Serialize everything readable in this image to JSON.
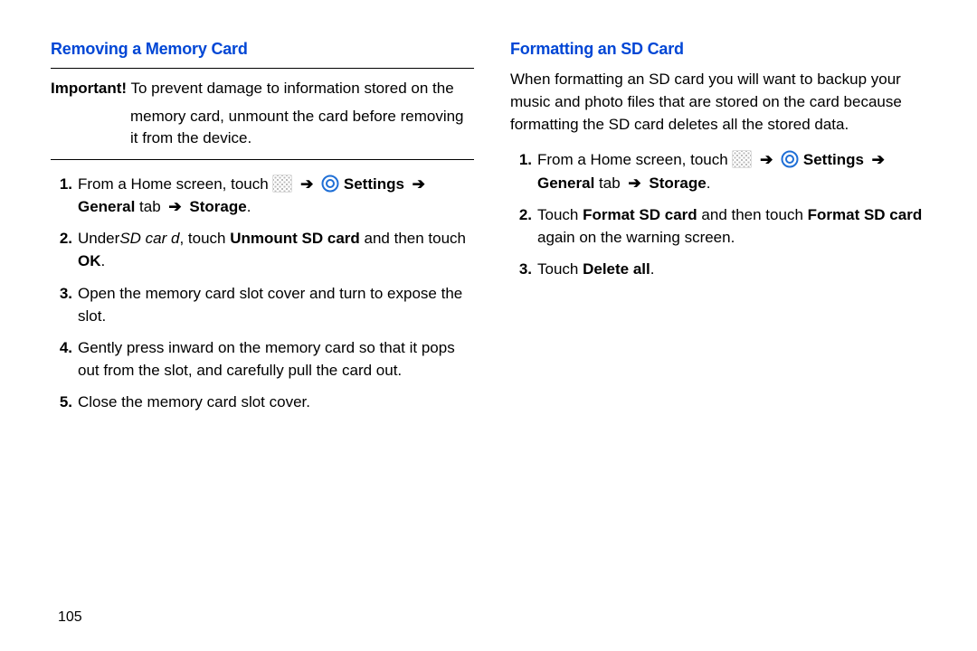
{
  "page_number": "105",
  "left": {
    "heading": "Removing a Memory Card",
    "important_label": "Important!",
    "important_text_first": " To prevent damage to information stored on the",
    "important_text_cont": "memory card, unmount the card before removing it from the device.",
    "steps": {
      "s1_pre": "From a Home screen, touch ",
      "s1_settings": "Settings",
      "s1_general_pre": "General",
      "s1_general_post": " tab ",
      "s1_storage": "Storage",
      "s2_pre": "Under",
      "s2_italic": "SD car d",
      "s2_mid": ", touch ",
      "s2_unmount": "Unmount SD card",
      "s2_post": " and then touch ",
      "s2_ok": "OK",
      "s3": "Open the memory card slot cover and turn to expose the slot.",
      "s4": "Gently press inward on the memory card so that it pops out from the slot, and carefully pull the card out.",
      "s5": "Close the memory card slot cover."
    }
  },
  "right": {
    "heading": "Formatting an SD Card",
    "intro": "When formatting an SD card you will want to backup your music and photo files that are stored on the card because formatting the SD card deletes all the stored data.",
    "steps": {
      "s1_pre": "From a Home screen, touch ",
      "s1_settings": "Settings",
      "s1_general_pre": "General",
      "s1_general_post": " tab ",
      "s1_storage": "Storage",
      "s2_pre": "Touch ",
      "s2_format1": "Format SD card",
      "s2_mid": " and then touch ",
      "s2_format2": "Format SD card",
      "s2_post": " again on the warning screen.",
      "s3_pre": "Touch ",
      "s3_delete": "Delete all"
    }
  },
  "arrow_glyph": "➔"
}
